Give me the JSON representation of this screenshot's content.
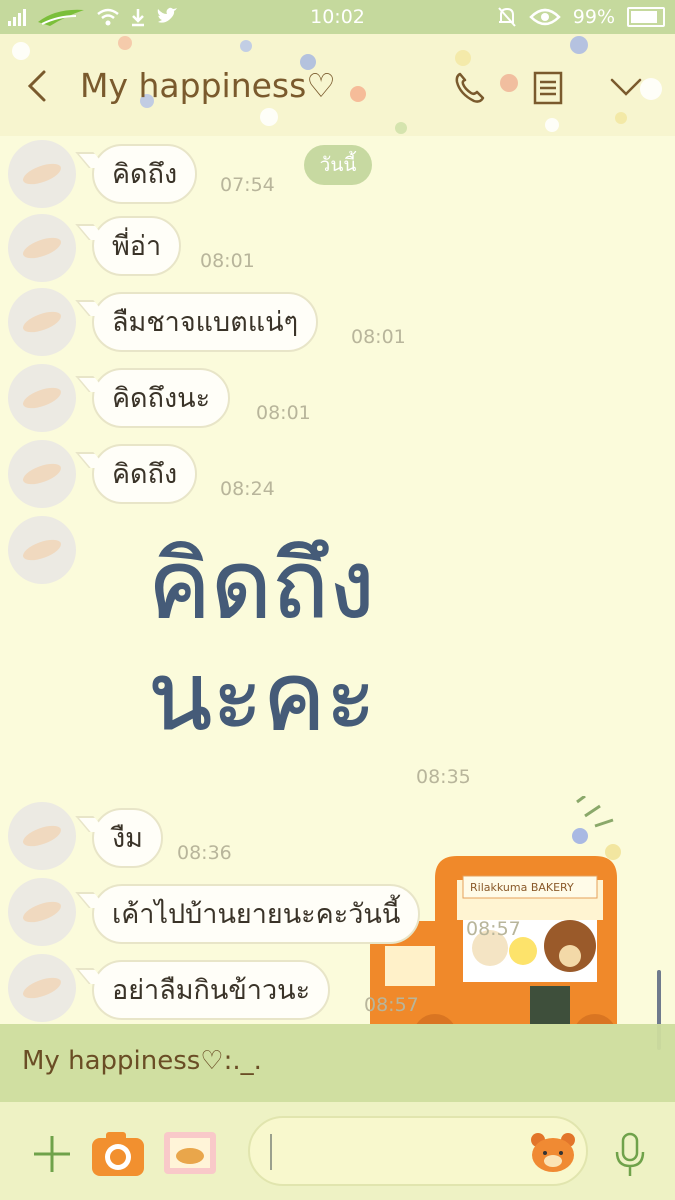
{
  "status_bar": {
    "time": "10:02",
    "battery": "99%"
  },
  "header": {
    "title": "My happiness♡"
  },
  "chat": {
    "day_tag": "วันนี้",
    "messages": [
      {
        "text": "คิดถึง",
        "time": "07:54"
      },
      {
        "text": "พี่อ่า",
        "time": "08:01"
      },
      {
        "text": "ลืมชาจแบตแน่ๆ",
        "time": "08:01"
      },
      {
        "text": "คิดถึงนะ",
        "time": "08:01"
      },
      {
        "text": "คิดถึง",
        "time": "08:24"
      },
      {
        "text": "งืม",
        "time": "08:36"
      },
      {
        "text": "เค้าไปบ้านยายนะคะวันนี้",
        "time": "08:57"
      },
      {
        "text": "อย่าลืมกินข้าวนะ",
        "time": "08:57"
      }
    ],
    "sticker": {
      "line1": "คิดถึง",
      "line2": "นะคะ",
      "time": "08:35"
    },
    "truck_sign": "Rilakkuma BAKERY"
  },
  "notification": {
    "text": "My happiness♡:._."
  },
  "colors": {
    "status_bg": "#c5d99d",
    "header_bg": "#f7f5cf",
    "chat_bg": "#fbfbdb",
    "title_text": "#7a5a2d",
    "accent_green": "#6fa24a"
  },
  "icons": [
    "back-icon",
    "phone-icon",
    "notes-icon",
    "chevron-down-icon",
    "plus-icon",
    "camera-icon",
    "photo-icon",
    "bear-sticker-icon",
    "mic-icon"
  ]
}
